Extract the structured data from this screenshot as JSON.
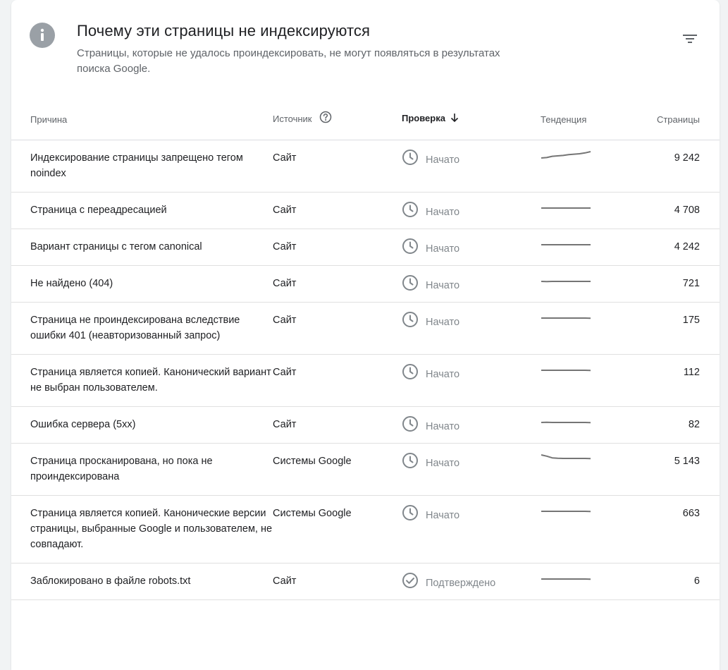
{
  "header": {
    "title": "Почему эти страницы не индексируются",
    "subtitle": "Страницы, которые не удалось проиндексировать, не могут появляться в результатах поиска Google."
  },
  "columns": {
    "reason": "Причина",
    "source": "Источник",
    "check": "Проверка",
    "trend": "Тенденция",
    "pages": "Страницы"
  },
  "rows": [
    {
      "reason": "Индексирование страницы запрещено тегом noindex",
      "source": "Сайт",
      "status": "Начато",
      "status_icon": "clock-icon",
      "pages": "9 242",
      "trend": [
        0.25,
        0.3,
        0.45,
        0.5,
        0.55,
        0.65,
        0.7,
        0.75,
        0.85,
        1.0
      ]
    },
    {
      "reason": "Страница с переадресацией",
      "source": "Сайт",
      "status": "Начато",
      "status_icon": "clock-icon",
      "pages": "4 708",
      "trend": [
        0.5,
        0.5,
        0.5,
        0.5,
        0.5,
        0.5,
        0.5,
        0.5,
        0.5,
        0.5
      ]
    },
    {
      "reason": "Вариант страницы с тегом canonical",
      "source": "Сайт",
      "status": "Начато",
      "status_icon": "clock-icon",
      "pages": "4 242",
      "trend": [
        0.5,
        0.5,
        0.5,
        0.5,
        0.5,
        0.5,
        0.5,
        0.5,
        0.5,
        0.5
      ]
    },
    {
      "reason": "Не найдено (404)",
      "source": "Сайт",
      "status": "Начато",
      "status_icon": "clock-icon",
      "pages": "721",
      "trend": [
        0.5,
        0.48,
        0.5,
        0.5,
        0.5,
        0.5,
        0.5,
        0.5,
        0.5,
        0.5
      ]
    },
    {
      "reason": "Страница не проиндексирована вследствие ошибки 401 (неавторизованный запрос)",
      "source": "Сайт",
      "status": "Начато",
      "status_icon": "clock-icon",
      "pages": "175",
      "trend": [
        0.5,
        0.5,
        0.5,
        0.5,
        0.5,
        0.5,
        0.5,
        0.5,
        0.5,
        0.48
      ]
    },
    {
      "reason": "Страница является копией. Канонический вариант не выбран пользователем.",
      "source": "Сайт",
      "status": "Начато",
      "status_icon": "clock-icon",
      "pages": "112",
      "trend": [
        0.5,
        0.5,
        0.5,
        0.5,
        0.5,
        0.5,
        0.5,
        0.5,
        0.5,
        0.48
      ]
    },
    {
      "reason": "Ошибка сервера (5xx)",
      "source": "Сайт",
      "status": "Начато",
      "status_icon": "clock-icon",
      "pages": "82",
      "trend": [
        0.5,
        0.52,
        0.5,
        0.5,
        0.5,
        0.5,
        0.5,
        0.5,
        0.5,
        0.48
      ]
    },
    {
      "reason": "Страница просканирована, но пока не проиндексирована",
      "source": "Системы Google",
      "status": "Начато",
      "status_icon": "clock-icon",
      "pages": "5 143",
      "trend": [
        1.0,
        0.85,
        0.65,
        0.6,
        0.58,
        0.58,
        0.58,
        0.58,
        0.58,
        0.56
      ]
    },
    {
      "reason": "Страница является копией. Канонические версии страницы, выбранные Google и пользователем, не совпадают.",
      "source": "Системы Google",
      "status": "Начато",
      "status_icon": "clock-icon",
      "pages": "663",
      "trend": [
        0.5,
        0.5,
        0.5,
        0.5,
        0.5,
        0.5,
        0.5,
        0.5,
        0.5,
        0.48
      ]
    },
    {
      "reason": "Заблокировано в файле robots.txt",
      "source": "Сайт",
      "status": "Подтверждено",
      "status_icon": "check-circle-icon",
      "pages": "6",
      "trend": [
        0.5,
        0.5,
        0.5,
        0.5,
        0.5,
        0.5,
        0.5,
        0.5,
        0.5,
        0.48
      ]
    }
  ]
}
